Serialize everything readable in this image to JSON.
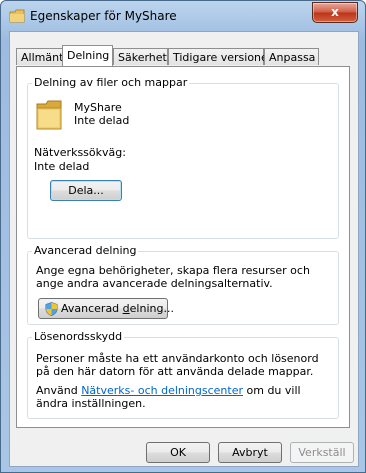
{
  "window": {
    "title": "Egenskaper för MyShare",
    "close_label": "x"
  },
  "tabs": [
    {
      "label": "Allmänt"
    },
    {
      "label": "Delning"
    },
    {
      "label": "Säkerhet"
    },
    {
      "label": "Tidigare versioner"
    },
    {
      "label": "Anpassa"
    }
  ],
  "sharing": {
    "group_title": "Delning av filer och mappar",
    "folder_name": "MyShare",
    "folder_status": "Inte delad",
    "path_label": "Nätverkssökväg:",
    "path_value": "Inte delad",
    "share_button": "Dela..."
  },
  "advanced": {
    "group_title": "Avancerad delning",
    "description": "Ange egna behörigheter, skapa flera resurser och ange andra avancerade delningsalternativ.",
    "button_prefix": "Avancerad ",
    "button_underlined": "d",
    "button_suffix": "elning..."
  },
  "password": {
    "group_title": "Lösenordsskydd",
    "description": "Personer måste ha ett användarkonto och lösenord på den här datorn för att använda delade mappar.",
    "text_before_link": "Använd ",
    "link_text": "Nätverks- och delningscenter",
    "text_after_link": " om du vill ändra inställningen."
  },
  "footer": {
    "ok": "OK",
    "cancel": "Avbryt",
    "apply": "Verkställ"
  }
}
